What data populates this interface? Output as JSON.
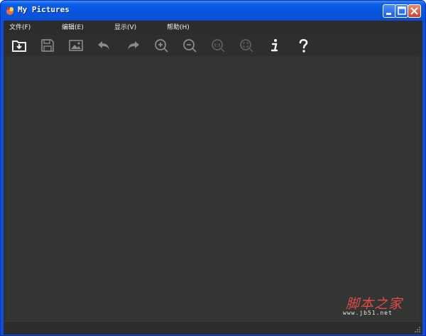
{
  "window": {
    "title": "My Pictures",
    "controls": {
      "minimize": "minimize",
      "maximize": "maximize",
      "close": "close"
    }
  },
  "menu": {
    "items": [
      {
        "label": "文件(F)"
      },
      {
        "label": "编辑(E)"
      },
      {
        "label": "显示(V)"
      },
      {
        "label": "帮助(H)"
      }
    ]
  },
  "toolbar": {
    "tools": [
      {
        "name": "open-icon"
      },
      {
        "name": "save-icon"
      },
      {
        "name": "image-icon"
      },
      {
        "name": "undo-icon"
      },
      {
        "name": "redo-icon"
      },
      {
        "name": "zoom-in-icon"
      },
      {
        "name": "zoom-out-icon"
      },
      {
        "name": "actual-size-icon"
      },
      {
        "name": "fit-window-icon"
      },
      {
        "name": "info-icon"
      },
      {
        "name": "help-icon"
      }
    ]
  },
  "watermark": {
    "text": "脚本之家",
    "url": "www.jb51.net"
  },
  "colors": {
    "accent": "#0a4fd6",
    "background": "#303030",
    "watermark": "#e04b4b"
  }
}
